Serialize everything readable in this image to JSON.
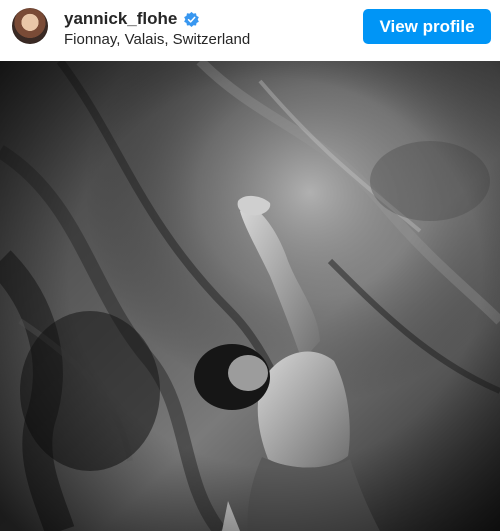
{
  "post": {
    "username": "yannick_flohe",
    "location": "Fionnay, Valais, Switzerland",
    "view_profile_label": "View profile"
  },
  "icons": {
    "avatar": "profile-avatar",
    "verified": "verified-badge-icon"
  },
  "colors": {
    "accent": "#0095f6",
    "verified": "#3897f0",
    "text": "#262626"
  }
}
